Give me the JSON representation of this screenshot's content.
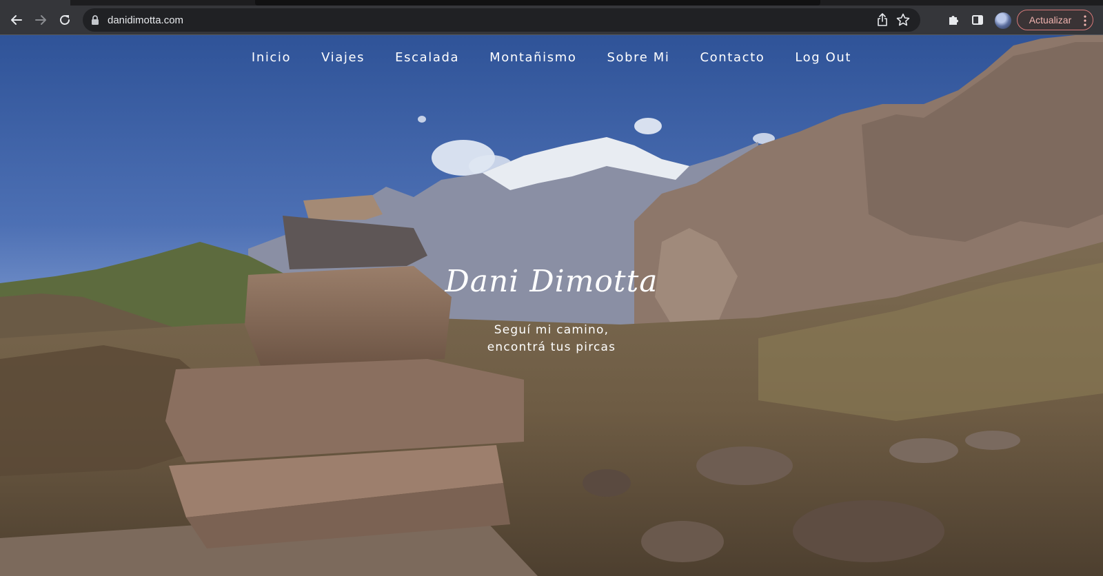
{
  "browser": {
    "url": "danidimotta.com",
    "update_button_label": "Actualizar",
    "accent_update": "#d97a7a"
  },
  "site": {
    "nav": [
      {
        "label": "Inicio"
      },
      {
        "label": "Viajes"
      },
      {
        "label": "Escalada"
      },
      {
        "label": "Montañismo"
      },
      {
        "label": "Sobre Mi"
      },
      {
        "label": "Contacto"
      },
      {
        "label": "Log Out"
      }
    ],
    "title": "Dani Dimotta",
    "tagline_line1": "Seguí mi camino,",
    "tagline_line2": "encontrá tus pircas"
  },
  "icons": {
    "back": "arrow-left-icon",
    "forward": "arrow-right-icon",
    "reload": "reload-icon",
    "lock": "lock-icon",
    "share": "share-icon",
    "bookmark": "star-icon",
    "extensions": "puzzle-icon",
    "side_panel": "side-panel-icon",
    "menu": "kebab-menu-icon"
  }
}
